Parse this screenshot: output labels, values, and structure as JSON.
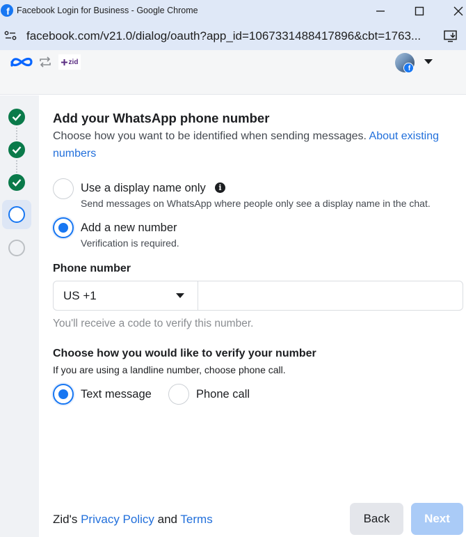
{
  "window": {
    "title": "Facebook Login for Business - Google Chrome",
    "minimize_icon": "minimize-icon",
    "maximize_icon": "maximize-icon",
    "close_icon": "close-icon"
  },
  "browser": {
    "url": "facebook.com/v21.0/dialog/oauth?app_id=1067331488417896&cbt=1763..."
  },
  "header": {
    "partner_logo_text": "zid"
  },
  "stepper": {
    "steps": [
      "done",
      "done",
      "done",
      "current",
      "todo"
    ]
  },
  "page": {
    "title": "Add your WhatsApp phone number",
    "subtitle": "Choose how you want to be identified when sending messages. ",
    "subtitle_link": "About existing numbers",
    "options": [
      {
        "label": "Use a display name only",
        "description": "Send messages on WhatsApp where people only see a display name in the chat.",
        "selected": false
      },
      {
        "label": "Add a new number",
        "description": "Verification is required.",
        "selected": true
      }
    ],
    "phone_label": "Phone number",
    "country_code": "US +1",
    "phone_value": "",
    "phone_hint": "You'll receive a code to verify this number.",
    "verify_title": "Choose how you would like to verify your number",
    "verify_subtitle": "If you are using a landline number, choose phone call.",
    "verify_options": [
      {
        "label": "Text message",
        "selected": true
      },
      {
        "label": "Phone call",
        "selected": false
      }
    ]
  },
  "footer": {
    "prefix": "Zid's ",
    "privacy_link": "Privacy Policy",
    "and": " and ",
    "terms_link": "Terms",
    "back_label": "Back",
    "next_label": "Next"
  },
  "colors": {
    "accent": "#1877f2",
    "step_done": "#0a7a4a",
    "link": "#216fdb",
    "next_disabled": "#aacbf7"
  }
}
